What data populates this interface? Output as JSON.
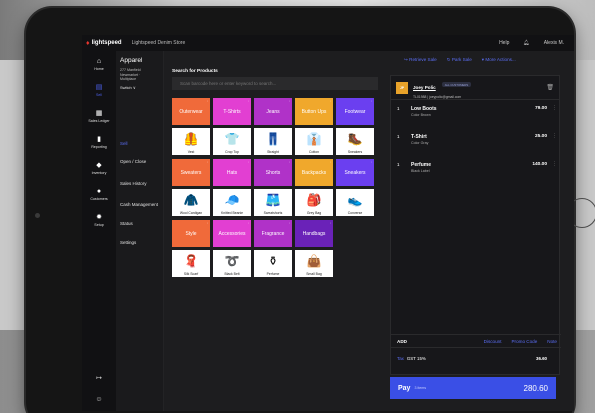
{
  "topbar": {
    "brand": "lightspeed",
    "store": "Lightspeed Denim Store",
    "help": "Help",
    "user": "Alexis M."
  },
  "leftnav": [
    {
      "label": "Home",
      "icon": "home-icon",
      "glyph": "⌂"
    },
    {
      "label": "Sell",
      "icon": "register-icon",
      "glyph": "▤"
    },
    {
      "label": "Sales Ledger",
      "icon": "ledger-icon",
      "glyph": "▦"
    },
    {
      "label": "Reporting",
      "icon": "chart-icon",
      "glyph": "▮"
    },
    {
      "label": "Inventory",
      "icon": "tag-icon",
      "glyph": "◆"
    },
    {
      "label": "Customers",
      "icon": "people-icon",
      "glyph": "●"
    },
    {
      "label": "Setup",
      "icon": "gear-icon",
      "glyph": "✹"
    }
  ],
  "subnav": {
    "title": "Apparel",
    "address": [
      "277 Manfield",
      "Newmarket ·",
      "Multiplace"
    ],
    "switch": "Switch ∨",
    "items": [
      "Sell",
      "Open / Close",
      "Sales History",
      "Cash Management",
      "Status",
      "Settings"
    ]
  },
  "search": {
    "label": "Search for Products",
    "placeholder": "Scan barcode here or enter keyword to search..."
  },
  "categories": [
    {
      "label": "Outerwear",
      "color": "#f06a3a"
    },
    {
      "label": "T-Shirts",
      "color": "#e23fd2"
    },
    {
      "label": "Jeans",
      "color": "#b032c8"
    },
    {
      "label": "Button Ups",
      "color": "#f0a82c"
    },
    {
      "label": "Footwear",
      "color": "#6b3ff0"
    },
    {
      "label": "Sweaters",
      "color": "#f06a3a"
    },
    {
      "label": "Hats",
      "color": "#e23fd2"
    },
    {
      "label": "Shorts",
      "color": "#b032c8"
    },
    {
      "label": "Backpacks",
      "color": "#f0a82c"
    },
    {
      "label": "Sneakers",
      "color": "#6b3ff0"
    },
    {
      "label": "Style",
      "color": "#f06a3a"
    },
    {
      "label": "Accessories",
      "color": "#e23fd2"
    },
    {
      "label": "Fragrance",
      "color": "#b032c8"
    },
    {
      "label": "Handbags",
      "color": "#6a22b8"
    }
  ],
  "products": [
    {
      "label": "Vest",
      "glyph": "🦺"
    },
    {
      "label": "Crop Top",
      "glyph": "👕"
    },
    {
      "label": "Straight",
      "glyph": "👖"
    },
    {
      "label": "Cotton",
      "glyph": "👔"
    },
    {
      "label": "Sneakers",
      "glyph": "🥾"
    },
    {
      "label": "Wool Cardigan",
      "glyph": "🧥"
    },
    {
      "label": "Knitted Beanie",
      "glyph": "🧢"
    },
    {
      "label": "Sweatshorts",
      "glyph": "🩳"
    },
    {
      "label": "Grey Bag",
      "glyph": "🎒"
    },
    {
      "label": "Converse",
      "glyph": "👟"
    },
    {
      "label": "Silk Scarf",
      "glyph": "🧣"
    },
    {
      "label": "Black Belt",
      "glyph": "➰"
    },
    {
      "label": "Perfume",
      "glyph": "⚱"
    },
    {
      "label": "Small Bag",
      "glyph": "👜"
    }
  ],
  "actions": {
    "retrieve": "Retrieve Sale",
    "park": "Park Sale",
    "more": "More Actions..."
  },
  "customer": {
    "initials": "JP",
    "name": "Joey Polic",
    "tag": "ALL CUSTOMERS",
    "contact": "TL01988 | joeypolic@gmail.com"
  },
  "lines": [
    {
      "qty": "1",
      "name": "Low Boots",
      "variant": "Color Brown",
      "price": "79.00"
    },
    {
      "qty": "1",
      "name": "T-Shirt",
      "variant": "Color Gray",
      "price": "25.00"
    },
    {
      "qty": "1",
      "name": "Perfume",
      "variant": "Black Label",
      "price": "140.00"
    }
  ],
  "addrow": {
    "add": "ADD",
    "discount": "Discount",
    "promo": "Promo Code",
    "note": "Note"
  },
  "tax": {
    "label": "Tax",
    "name": "GST 15%",
    "value": "36.60"
  },
  "pay": {
    "label": "Pay",
    "items": "3 items",
    "total": "280.60"
  }
}
